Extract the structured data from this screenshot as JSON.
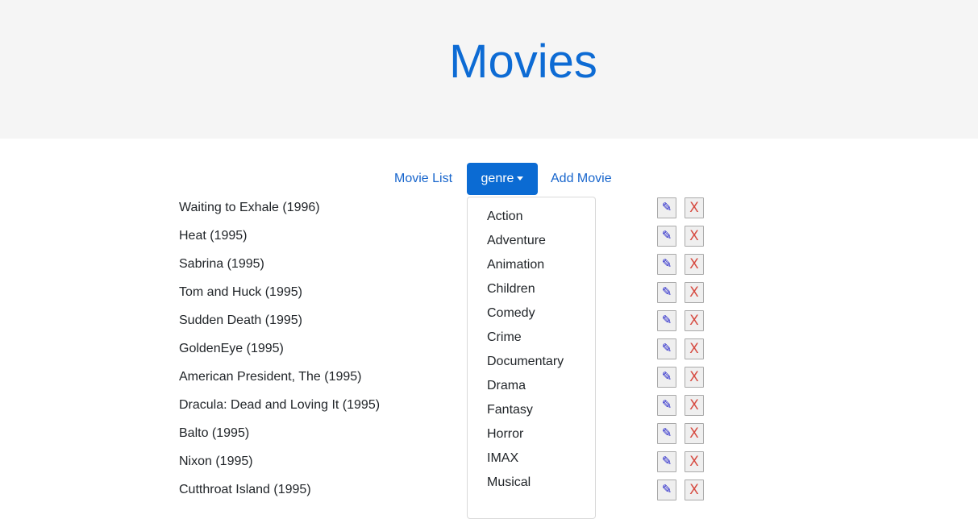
{
  "header": {
    "title": "Movies"
  },
  "nav": {
    "movie_list_label": "Movie List",
    "genre_label": "genre",
    "add_movie_label": "Add Movie"
  },
  "movies": [
    {
      "title": "Waiting to Exhale (1996)"
    },
    {
      "title": "Heat (1995)"
    },
    {
      "title": "Sabrina (1995)"
    },
    {
      "title": "Tom and Huck (1995)"
    },
    {
      "title": "Sudden Death (1995)"
    },
    {
      "title": "GoldenEye (1995)"
    },
    {
      "title": "American President, The (1995)"
    },
    {
      "title": "Dracula: Dead and Loving It (1995)"
    },
    {
      "title": "Balto (1995)"
    },
    {
      "title": "Nixon (1995)"
    },
    {
      "title": "Cutthroat Island (1995)"
    }
  ],
  "actions": {
    "edit_glyph": "✎",
    "delete_glyph": "X"
  },
  "genre_dropdown": {
    "items": [
      "Action",
      "Adventure",
      "Animation",
      "Children",
      "Comedy",
      "Crime",
      "Documentary",
      "Drama",
      "Fantasy",
      "Horror",
      "IMAX",
      "Musical"
    ]
  },
  "icons": {
    "edit": "pencil-icon",
    "delete": "x-icon",
    "genre_toggle": "caret-down-icon"
  },
  "colors": {
    "title": "#0d6bd4",
    "link": "#1765cc",
    "primary_button": "#0b6bd3",
    "jumbotron_bg": "#f5f5f5",
    "edit_icon": "#1a1ac8",
    "delete_icon": "#d6493f"
  }
}
